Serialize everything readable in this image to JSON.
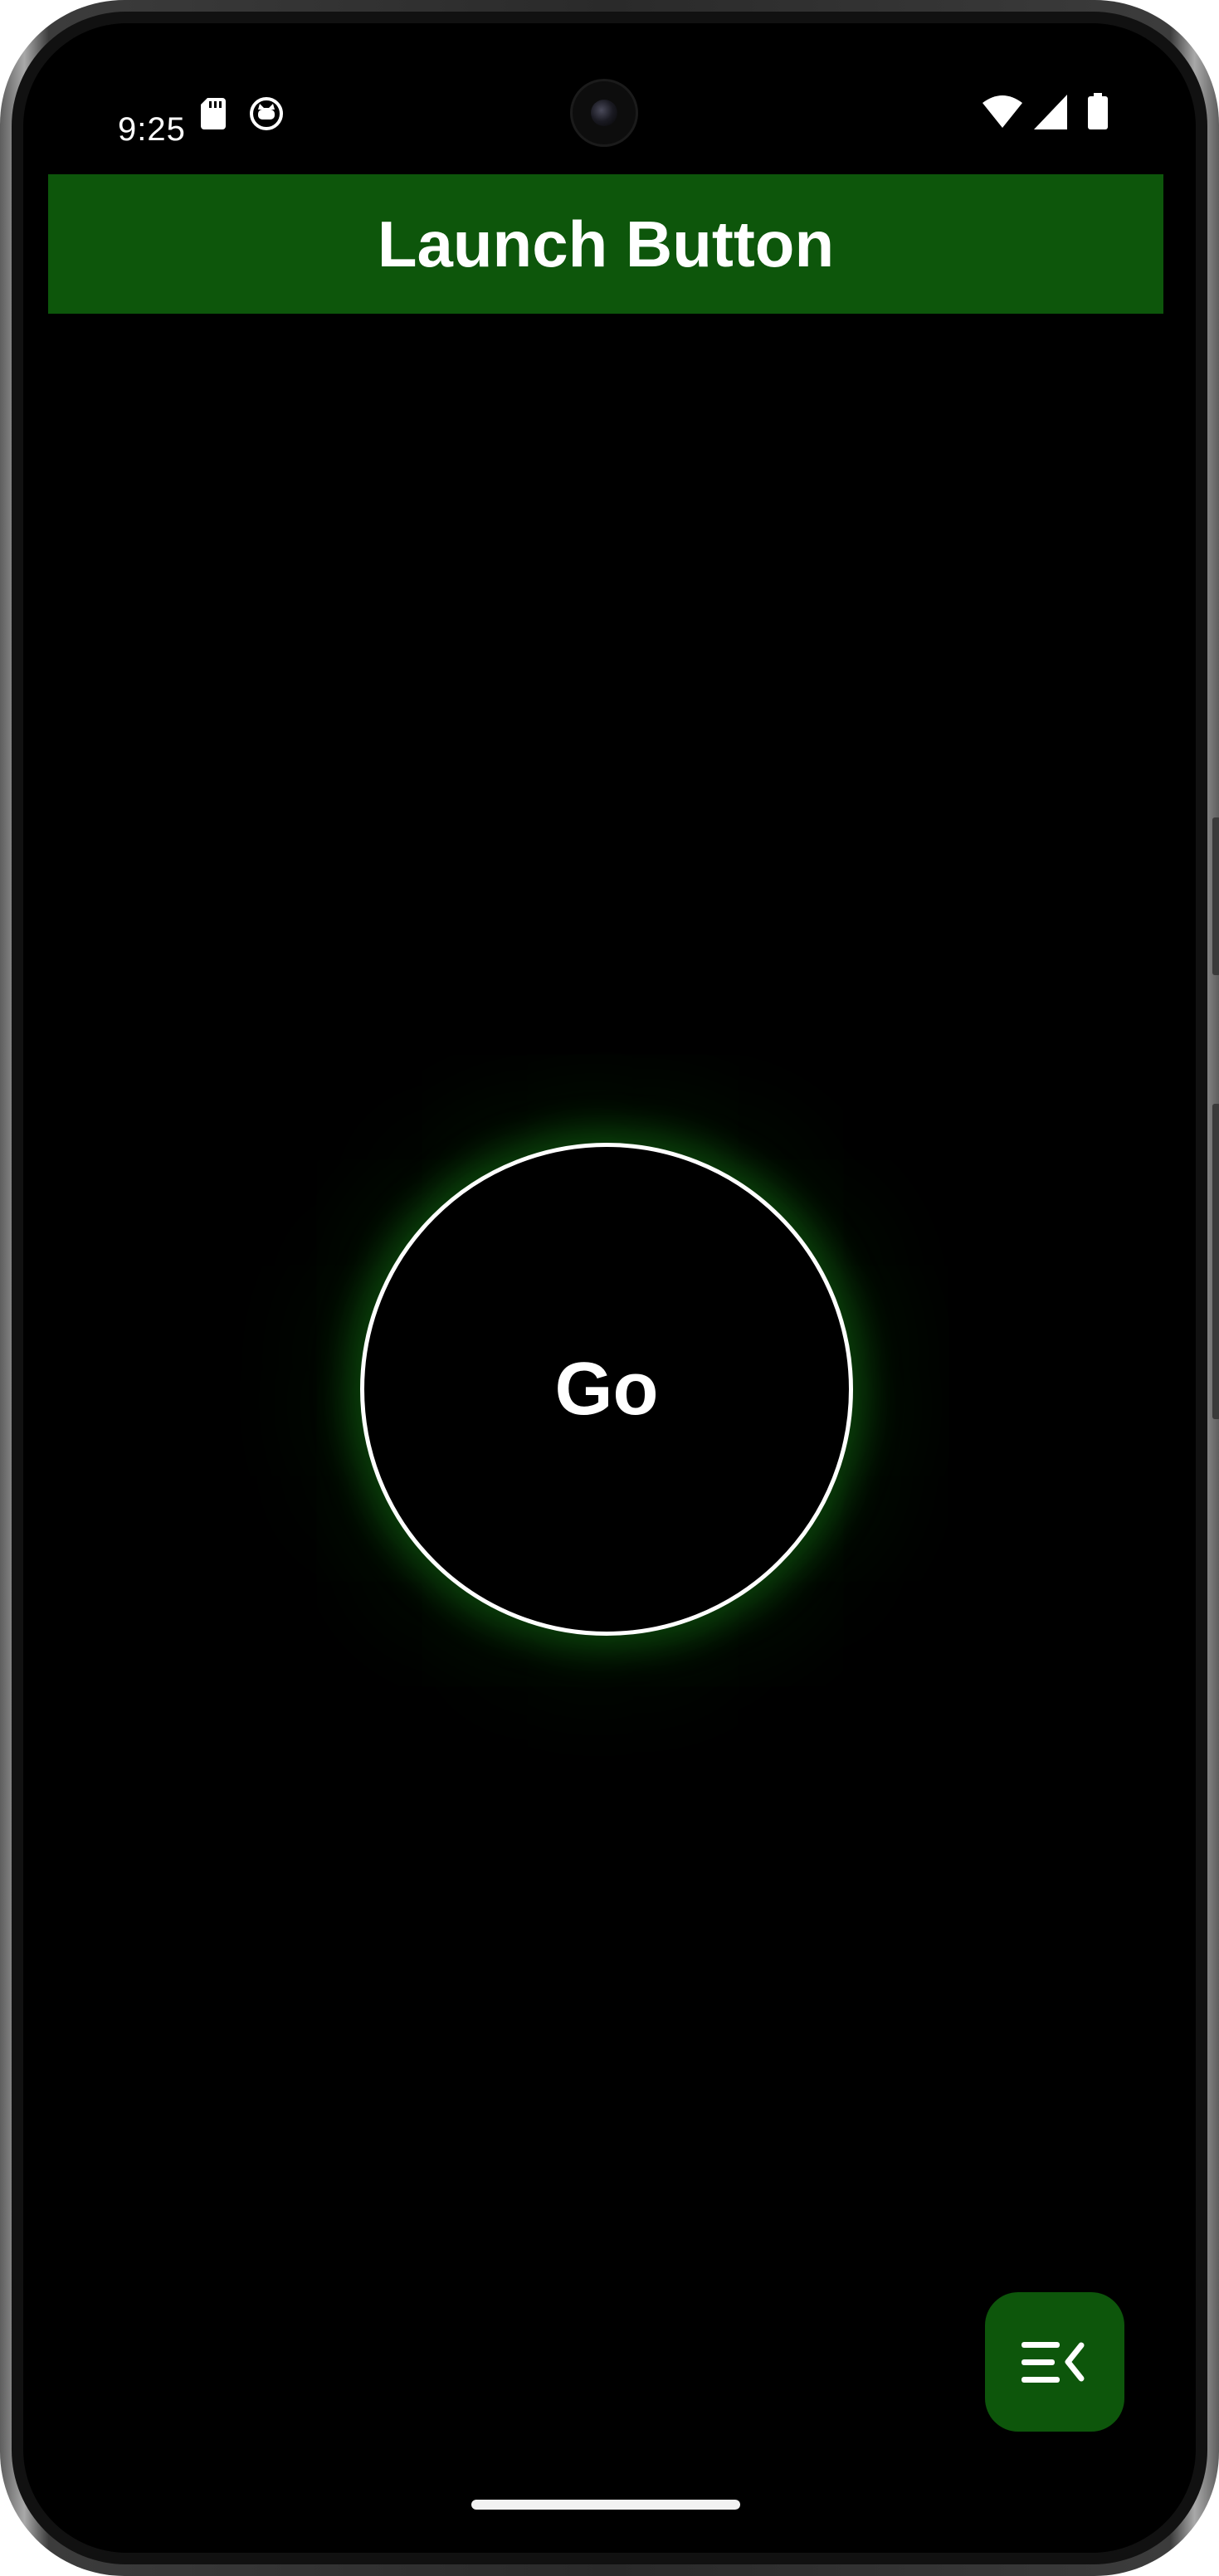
{
  "status_bar": {
    "time": "9:25",
    "icons": [
      "sd-card-icon",
      "cat-icon",
      "wifi-icon",
      "cell-signal-icon",
      "battery-icon"
    ]
  },
  "app_bar": {
    "title": "Launch Button",
    "color": "#0d560b"
  },
  "main": {
    "go_label": "Go",
    "glow_color": "#1ea01e",
    "ring_color": "#ffffff"
  },
  "fab": {
    "icon": "menu-collapse-icon",
    "color": "#0d560b"
  },
  "theme": {
    "background": "#000000",
    "text": "#ffffff"
  }
}
